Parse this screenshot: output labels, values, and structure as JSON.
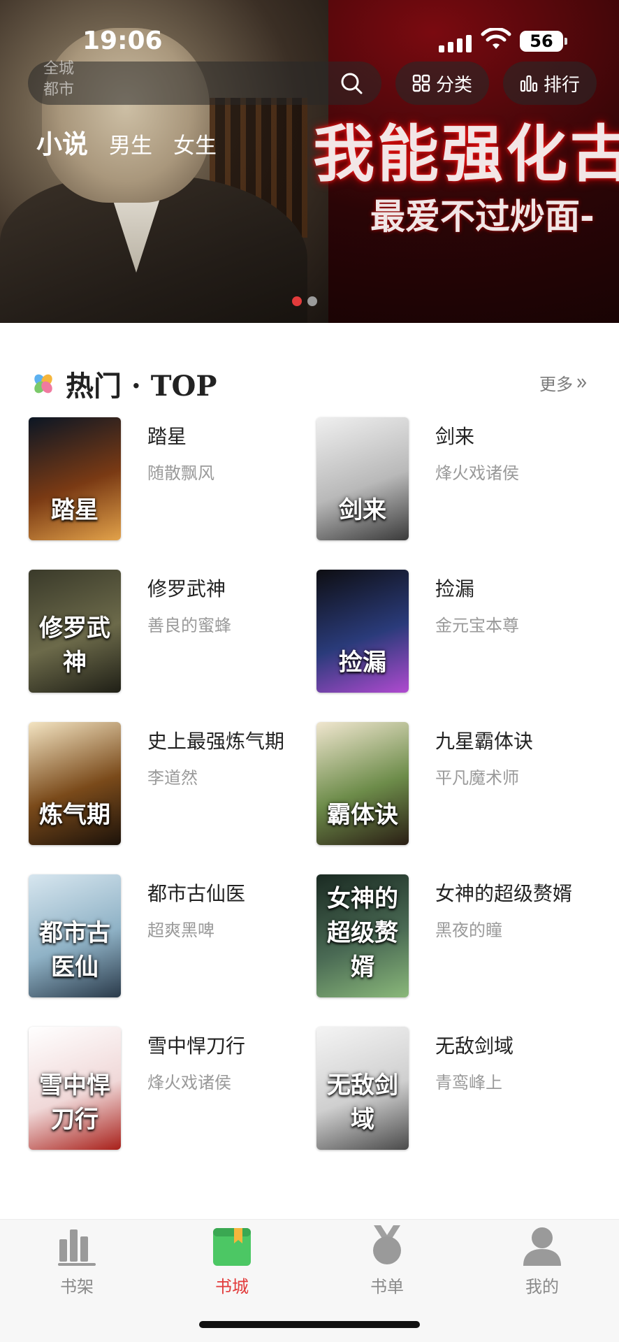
{
  "status_bar": {
    "time": "19:06",
    "battery": "56"
  },
  "header": {
    "search_ghost": "全城\n都市",
    "category_label": "分类",
    "ranking_label": "排行",
    "tabs": [
      {
        "label": "小说",
        "active": true
      },
      {
        "label": "男生"
      },
      {
        "label": "女生"
      }
    ]
  },
  "banner": {
    "title": "我能强化古",
    "subtitle": "最爱不过炒面-",
    "active_dot": 0,
    "dot_count": 2
  },
  "section": {
    "title": "热门 · TOP",
    "more_label": "更多",
    "books": [
      {
        "title": "踏星",
        "author": "随散飘风",
        "cover_text": "踏星",
        "cover_colors": [
          "#0b1624",
          "#7a3a14",
          "#e2a24a"
        ]
      },
      {
        "title": "剑来",
        "author": "烽火戏诸侯",
        "cover_text": "剑来",
        "cover_colors": [
          "#efefef",
          "#b9b9b9",
          "#3a3a3a"
        ]
      },
      {
        "title": "修罗武神",
        "author": "善良的蜜蜂",
        "cover_text": "修罗武神",
        "cover_colors": [
          "#3a3a2a",
          "#6c6a4a",
          "#1f1f16"
        ]
      },
      {
        "title": "捡漏",
        "author": "金元宝本尊",
        "cover_text": "捡漏",
        "cover_colors": [
          "#0e0e12",
          "#2a3b7a",
          "#b04ad0"
        ]
      },
      {
        "title": "史上最强炼气期",
        "author": "李道然",
        "cover_text": "炼气期",
        "cover_colors": [
          "#f3e4c2",
          "#7a4a1a",
          "#1c120a"
        ]
      },
      {
        "title": "九星霸体诀",
        "author": "平凡魔术师",
        "cover_text": "霸体诀",
        "cover_colors": [
          "#f0e6cf",
          "#6d8c4a",
          "#2a1e14"
        ]
      },
      {
        "title": "都市古仙医",
        "author": "超爽黑啤",
        "cover_text": "都市古医仙",
        "cover_colors": [
          "#d7e6ef",
          "#8fb2c6",
          "#2a3a4a"
        ]
      },
      {
        "title": "女神的超级赘婿",
        "author": "黑夜的瞳",
        "cover_text": "女神的超级赘婿",
        "cover_colors": [
          "#1a2a22",
          "#4a6a54",
          "#8ab87a"
        ]
      },
      {
        "title": "雪中悍刀行",
        "author": "烽火戏诸侯",
        "cover_text": "雪中悍刀行",
        "cover_colors": [
          "#ffffff",
          "#f0d8d8",
          "#a8201a"
        ]
      },
      {
        "title": "无敌剑域",
        "author": "青鸾峰上",
        "cover_text": "无敌剑域",
        "cover_colors": [
          "#f4f4f4",
          "#cfcfcf",
          "#4a4a4a"
        ]
      }
    ]
  },
  "bottom_nav": {
    "items": [
      {
        "label": "书架",
        "icon": "bookshelf-icon"
      },
      {
        "label": "书城",
        "icon": "bookstore-icon",
        "active": true
      },
      {
        "label": "书单",
        "icon": "medal-icon"
      },
      {
        "label": "我的",
        "icon": "profile-icon"
      }
    ]
  },
  "colors": {
    "accent": "#e23b3b",
    "muted_text": "#9a9a9a",
    "nav_bg": "#f7f7f7"
  }
}
